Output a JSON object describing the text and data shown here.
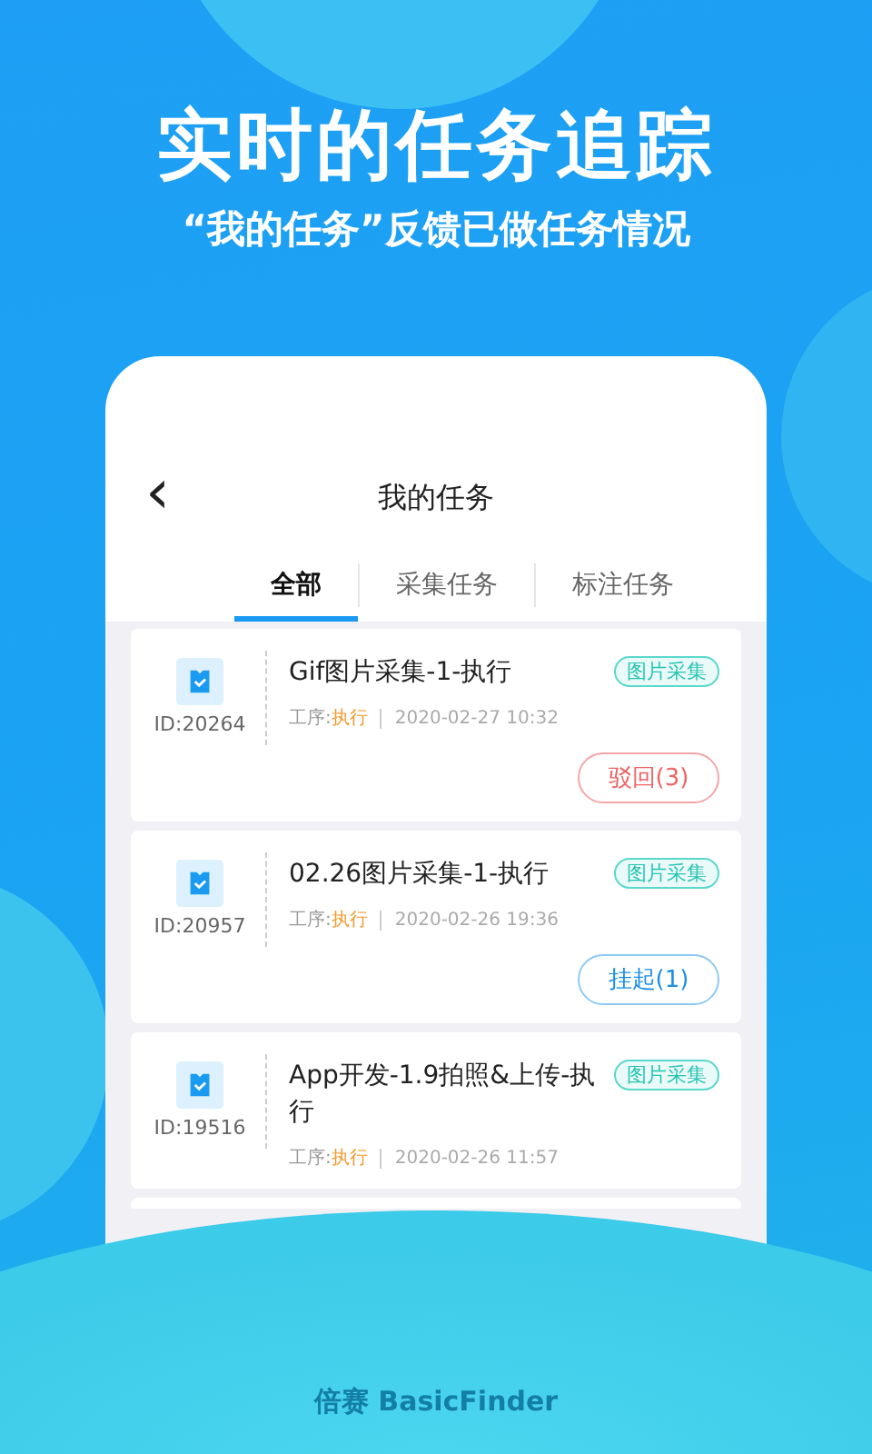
{
  "headline": "实时的任务追踪",
  "subheadline": "“我的任务”反馈已做任务情况",
  "screen": {
    "title": "我的任务",
    "back": "‹",
    "tabs": [
      {
        "label": "全部",
        "selected": true
      },
      {
        "label": "采集任务",
        "selected": false
      },
      {
        "label": "标注任务",
        "selected": false
      }
    ],
    "tasks": [
      {
        "id": "ID:20264",
        "title": "Gif图片采集-1-执行",
        "step_label": "工序:",
        "step": "执行",
        "time": "2020-02-27 10:32",
        "tag": "图片采集",
        "action": {
          "label": "驳回(3)",
          "kind": "reject"
        }
      },
      {
        "id": "ID:20957",
        "title": "02.26图片采集-1-执行",
        "step_label": "工序:",
        "step": "执行",
        "time": "2020-02-26 19:36",
        "tag": "图片采集",
        "action": {
          "label": "挂起(1)",
          "kind": "suspend"
        }
      },
      {
        "id": "ID:19516",
        "title": "App开发-1.9拍照&上传-执行",
        "step_label": "工序:",
        "step": "执行",
        "time": "2020-02-26 11:57",
        "tag": "图片采集"
      },
      {
        "kind": "partial"
      }
    ]
  },
  "brand": "倍赛 BasicFinder"
}
